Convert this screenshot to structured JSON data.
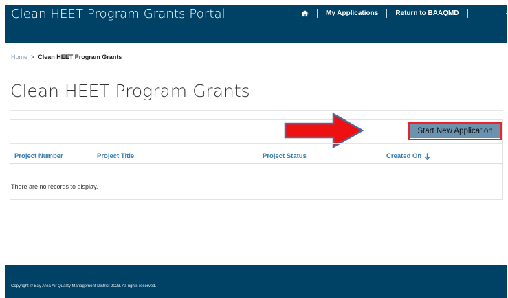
{
  "header": {
    "brand": "Clean HEET Program Grants Portal",
    "nav": {
      "home_icon": "home-icon",
      "my_applications": "My Applications",
      "return_link": "Return to BAAQMD",
      "extra": "-"
    }
  },
  "breadcrumb": {
    "home": "Home",
    "separator": ">",
    "current": "Clean HEET Program Grants"
  },
  "page": {
    "title": "Clean HEET Program Grants"
  },
  "toolbar": {
    "start_new_application": "Start New Application"
  },
  "table": {
    "columns": [
      "Project Number",
      "Project Title",
      "Project Status",
      "Created On"
    ],
    "sort_column": "Created On",
    "sort_direction": "descending",
    "empty_message": "There are no records to display."
  },
  "footer": {
    "copyright": "Copyright © Bay Area Air Quality Management District 2023. All rights reserved."
  },
  "colors": {
    "brand_navy": "#004166",
    "link_blue": "#3a7fb0",
    "button_fill": "#6b93b0",
    "highlight_red": "#e8232a",
    "arrow_red": "#ee1111",
    "arrow_outline": "#4a6aa0"
  }
}
